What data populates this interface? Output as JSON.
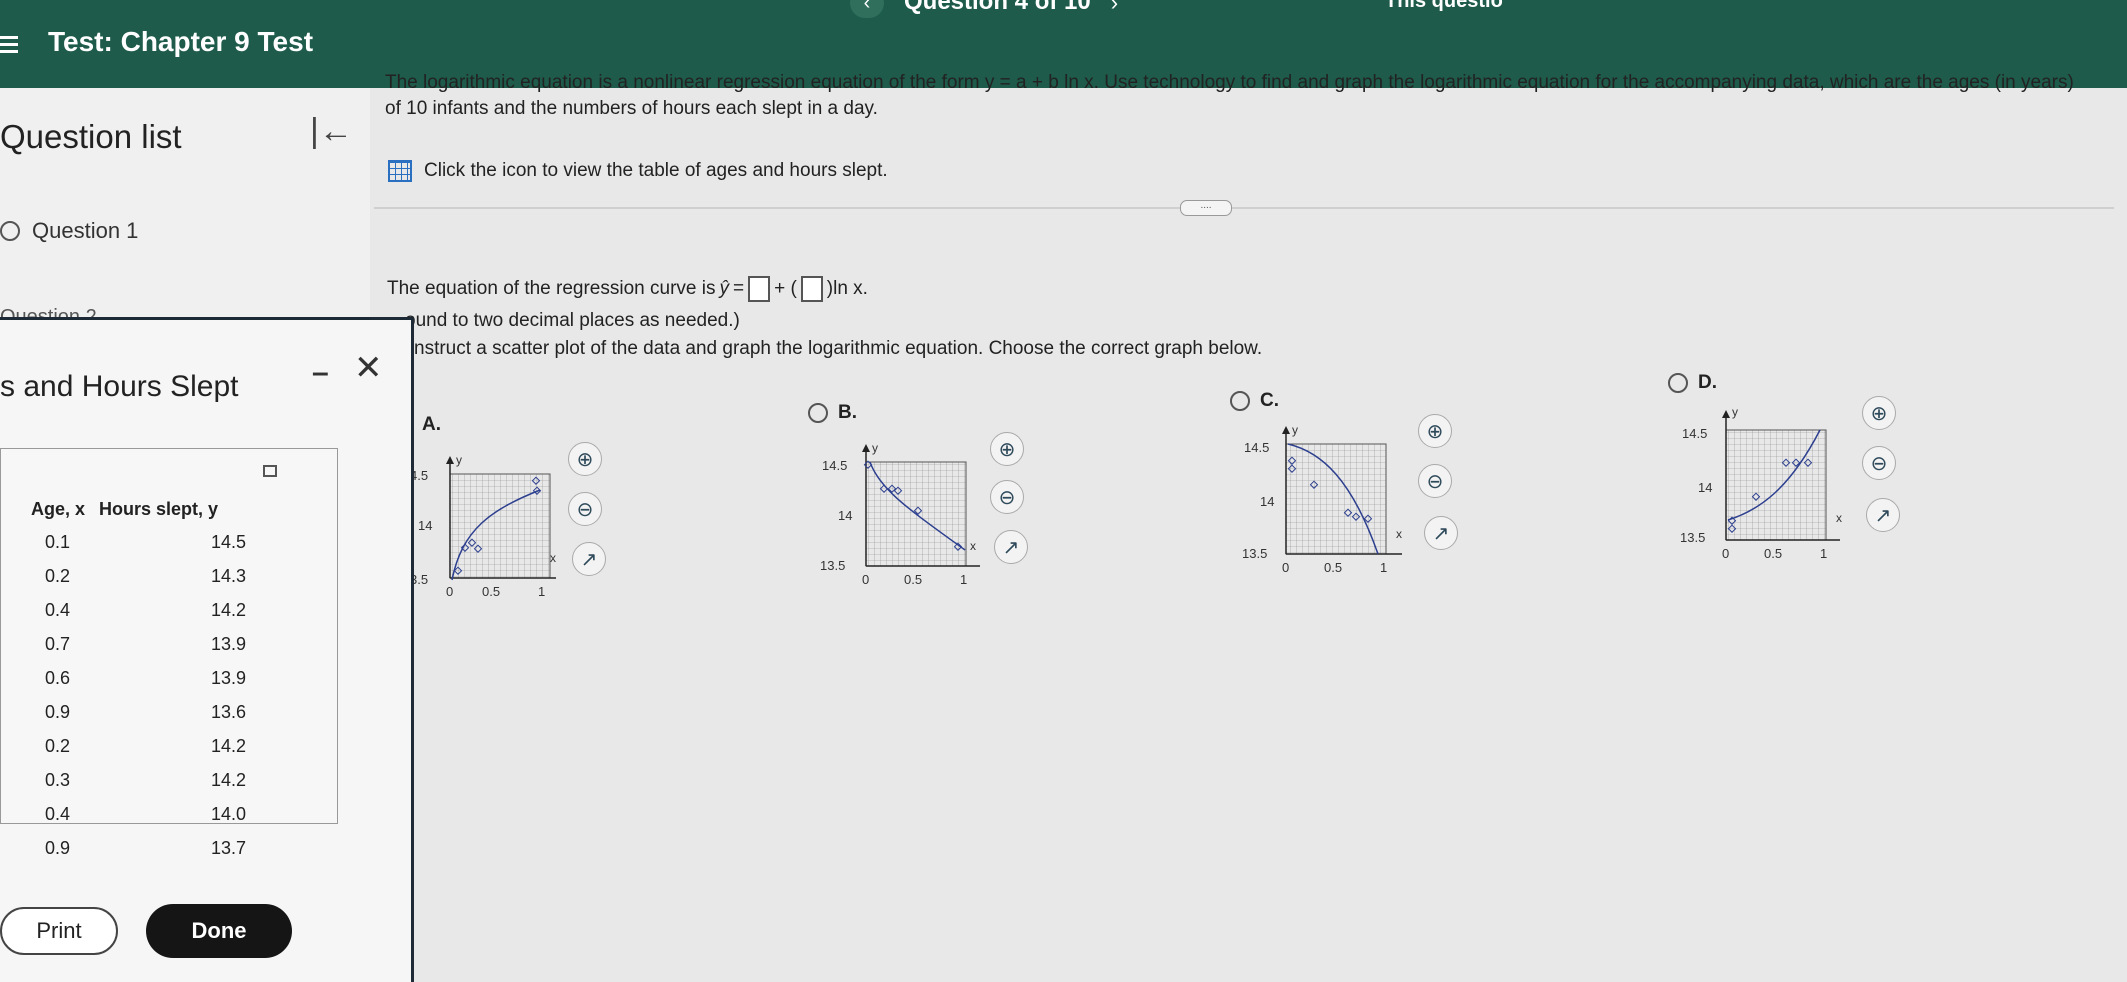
{
  "header": {
    "test_title": "Test: Chapter 9 Test",
    "question_counter": "Question 4 of 10",
    "top_right_text": "This questio"
  },
  "sidebar": {
    "title": "Question list",
    "items": [
      {
        "label": "Question 1"
      },
      {
        "label": "Question 2"
      }
    ]
  },
  "question": {
    "intro": "The logarithmic equation is a nonlinear regression equation of the form y = a + b ln x. Use technology to find and graph the logarithmic equation for the accompanying data, which are the ages (in years) of 10 infants and the numbers of hours each slept in a day.",
    "table_link": "Click the icon to view the table of ages and hours slept.",
    "more_button": "....",
    "equation_prefix": "The equation of the regression curve is",
    "y_hat": "ŷ",
    "equals_plus": "= ",
    "plus_paren": " + (",
    "ln_suffix": ")ln x.",
    "round_note": "ound to two decimal places as needed.)",
    "construct": "nstruct a scatter plot of the data and graph the logarithmic equation. Choose the correct graph below."
  },
  "options": [
    {
      "label": "A.",
      "y_ticks": [
        "4.5",
        "14",
        "3.5"
      ],
      "x_ticks": [
        "0",
        "0.5",
        "1"
      ],
      "axis_x": "x",
      "axis_y": "y"
    },
    {
      "label": "B.",
      "y_ticks": [
        "14.5",
        "14",
        "13.5"
      ],
      "x_ticks": [
        "0",
        "0.5",
        "1"
      ],
      "axis_x": "x",
      "axis_y": "y"
    },
    {
      "label": "C.",
      "y_ticks": [
        "14.5",
        "14",
        "13.5"
      ],
      "x_ticks": [
        "0",
        "0.5",
        "1"
      ],
      "axis_x": "x",
      "axis_y": "y"
    },
    {
      "label": "D.",
      "y_ticks": [
        "14.5",
        "14",
        "13.5"
      ],
      "x_ticks": [
        "0",
        "0.5",
        "1"
      ],
      "axis_x": "x",
      "axis_y": "y"
    }
  ],
  "popup": {
    "title": "s and Hours Slept",
    "columns": [
      "Age, x",
      "Hours slept, y"
    ],
    "rows": [
      [
        "0.1",
        "14.5"
      ],
      [
        "0.2",
        "14.3"
      ],
      [
        "0.4",
        "14.2"
      ],
      [
        "0.7",
        "13.9"
      ],
      [
        "0.6",
        "13.9"
      ],
      [
        "0.9",
        "13.6"
      ],
      [
        "0.2",
        "14.2"
      ],
      [
        "0.3",
        "14.2"
      ],
      [
        "0.4",
        "14.0"
      ],
      [
        "0.9",
        "13.7"
      ]
    ],
    "print_label": "Print",
    "done_label": "Done"
  },
  "colors": {
    "header_bg": "#1e5b4a",
    "curve": "#2d3f8f",
    "done_bg": "#151515"
  }
}
